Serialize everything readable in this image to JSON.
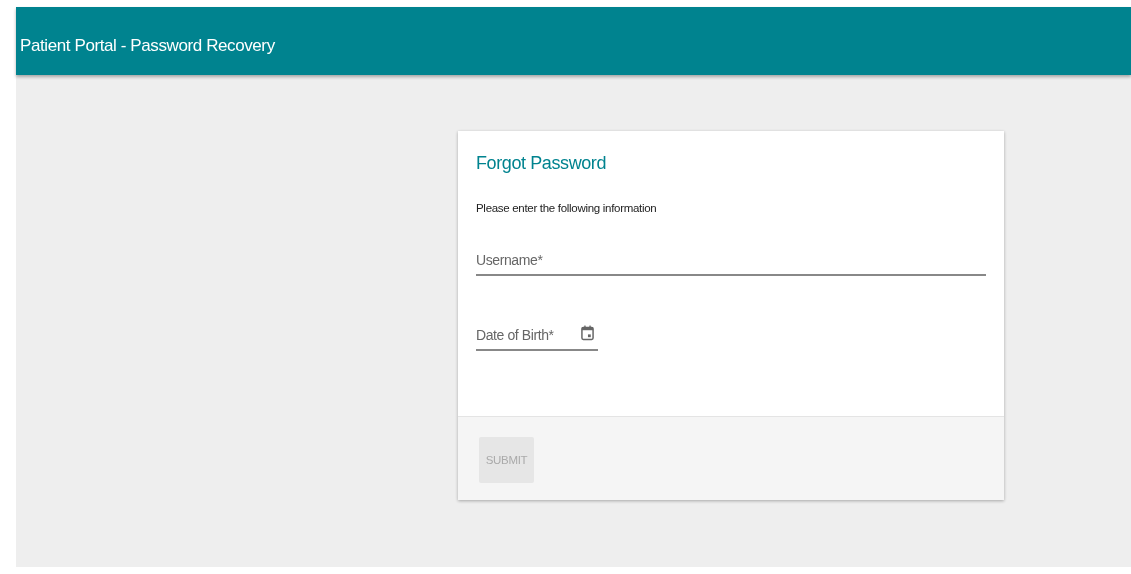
{
  "header": {
    "title": "Patient Portal - Password Recovery"
  },
  "card": {
    "title": "Forgot Password",
    "instructions": "Please enter the following information",
    "fields": [
      {
        "kind": "text",
        "placeholder": "Username*"
      },
      {
        "kind": "date",
        "placeholder": "Date of Birth*"
      }
    ],
    "submit": {
      "label": "SUBMIT",
      "disabled": true
    }
  }
}
